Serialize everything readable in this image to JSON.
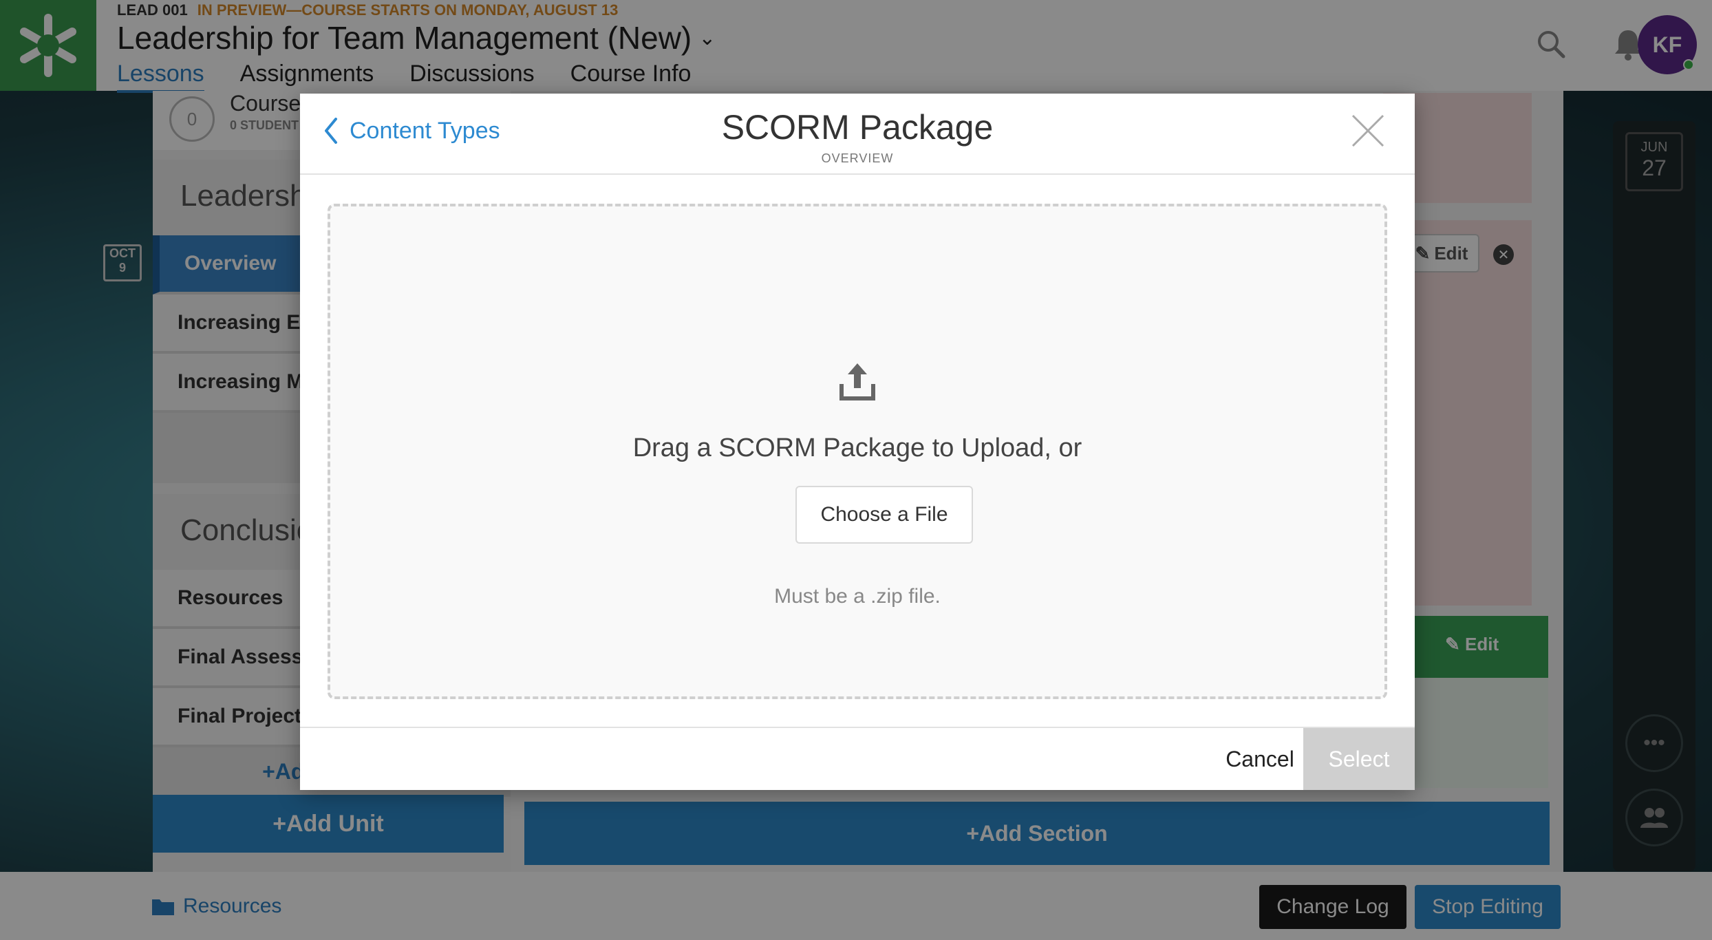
{
  "header": {
    "course_code": "LEAD 001",
    "preview_notice": "IN PREVIEW—COURSE STARTS ON MONDAY, AUGUST 13",
    "course_title": "Leadership for Team Management (New)",
    "tabs": [
      {
        "label": "Lessons",
        "active": true
      },
      {
        "label": "Assignments",
        "active": false
      },
      {
        "label": "Discussions",
        "active": false
      },
      {
        "label": "Course Info",
        "active": false
      }
    ],
    "avatar_initials": "KF",
    "icons": [
      "search-icon",
      "bell-icon"
    ]
  },
  "sidebar": {
    "students_count": "0",
    "students_label": "Course",
    "students_sub": "0 STUDENT",
    "date_badge": {
      "month": "OCT",
      "day": "9"
    },
    "units": [
      {
        "title": "Leadership",
        "lessons": [
          {
            "label": "Overview",
            "active": true
          },
          {
            "label": "Increasing Ef",
            "active": false
          },
          {
            "label": "Increasing M",
            "active": false
          }
        ],
        "add_lesson": "+Ad"
      },
      {
        "title": "Conclusion",
        "lessons": [
          {
            "label": "Resources",
            "active": false
          },
          {
            "label": "Final Assessn",
            "active": false
          },
          {
            "label": "Final Project",
            "active": false
          }
        ],
        "add_lesson": "+Add Lesson"
      }
    ],
    "add_unit": "+Add Unit"
  },
  "main": {
    "edit_label": "Edit",
    "add_section": "+Add Section"
  },
  "right_rail": {
    "date_badge": {
      "month": "JUN",
      "day": "27"
    }
  },
  "footer": {
    "resources": "Resources",
    "change_log": "Change Log",
    "stop_editing": "Stop Editing"
  },
  "modal": {
    "back_label": "Content Types",
    "title": "SCORM Package",
    "subtitle": "OVERVIEW",
    "drag_text": "Drag a SCORM Package to Upload, or",
    "choose_file": "Choose a File",
    "hint": "Must be a .zip file.",
    "cancel": "Cancel",
    "select": "Select"
  },
  "colors": {
    "accent": "#2d8ad1",
    "brand_green": "#3a9a4e",
    "preview_orange": "#d4892b",
    "avatar_purple": "#5b2a8a",
    "select_disabled": "#cfcfcf"
  }
}
